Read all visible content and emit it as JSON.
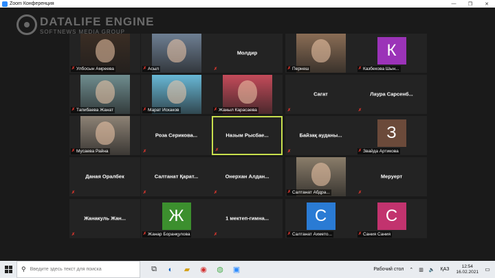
{
  "window": {
    "title": "Zoom Конференция",
    "minimize": "—",
    "maximize": "❐",
    "close": "✕"
  },
  "watermark": {
    "title": "DATALIFE ENGINE",
    "subtitle": "SOFTNEWS MEDIA GROUP"
  },
  "participants": [
    {
      "label": "Улбосын Амреева",
      "type": "photo",
      "bg": "#3a2d24"
    },
    {
      "label": "Асыл",
      "type": "photo",
      "bg": "#6e7f93"
    },
    {
      "name": "Молдир",
      "type": "name"
    },
    {
      "label": "Пернеш",
      "type": "photo",
      "bg": "#8a6d55"
    },
    {
      "label": "Казбекова Шын...",
      "type": "letter",
      "letter": "К",
      "color": "#9b33b8"
    },
    {
      "label": "Тапибаева Жанат",
      "type": "photo",
      "bg": "#6f8d8f"
    },
    {
      "label": "Марат Искаков",
      "type": "photo",
      "bg": "#68b8d6"
    },
    {
      "label": "Жаныл Карасаева",
      "type": "photo",
      "bg": "#c44b5a"
    },
    {
      "name": "Сагат",
      "type": "name"
    },
    {
      "name": "Лаура  Сарсенб...",
      "type": "name"
    },
    {
      "label": "Мусаева Райна",
      "type": "photo",
      "bg": "#8d8275"
    },
    {
      "name": "Роза  Серикова...",
      "type": "name"
    },
    {
      "name": "Назым  Рысбае...",
      "type": "name",
      "active": true
    },
    {
      "name": "Байзақ ауданы...",
      "type": "name"
    },
    {
      "label": "Звайда Артикова",
      "type": "letter",
      "letter": "З",
      "color": "#6b4a3a"
    },
    {
      "name": "Даная Оралбек",
      "type": "name"
    },
    {
      "name": "Салтанат Қарат...",
      "type": "name"
    },
    {
      "name": "Онерхан  Алдан...",
      "type": "name"
    },
    {
      "label": "Салтанат Абдра...",
      "type": "photo",
      "bg": "#8a7d6a"
    },
    {
      "name": "Меруерт",
      "type": "name"
    },
    {
      "name": "Жанакуль  Жан...",
      "type": "name"
    },
    {
      "label": "Жанар Боранқулова",
      "type": "letter",
      "letter": "Ж",
      "color": "#3c8f2e"
    },
    {
      "name": "1  мектеп-гимна...",
      "type": "name"
    },
    {
      "label": "Салтанат Ахмето...",
      "type": "letter",
      "letter": "С",
      "color": "#2a7bd4"
    },
    {
      "label": "Сания Сания",
      "type": "letter",
      "letter": "С",
      "color": "#c2336e"
    }
  ],
  "taskbar": {
    "search_placeholder": "Введите здесь текст для поиска",
    "desktop_label": "Рабочий стол",
    "lang": "ҚАЗ",
    "time": "12:54",
    "date": "16.02.2021"
  }
}
